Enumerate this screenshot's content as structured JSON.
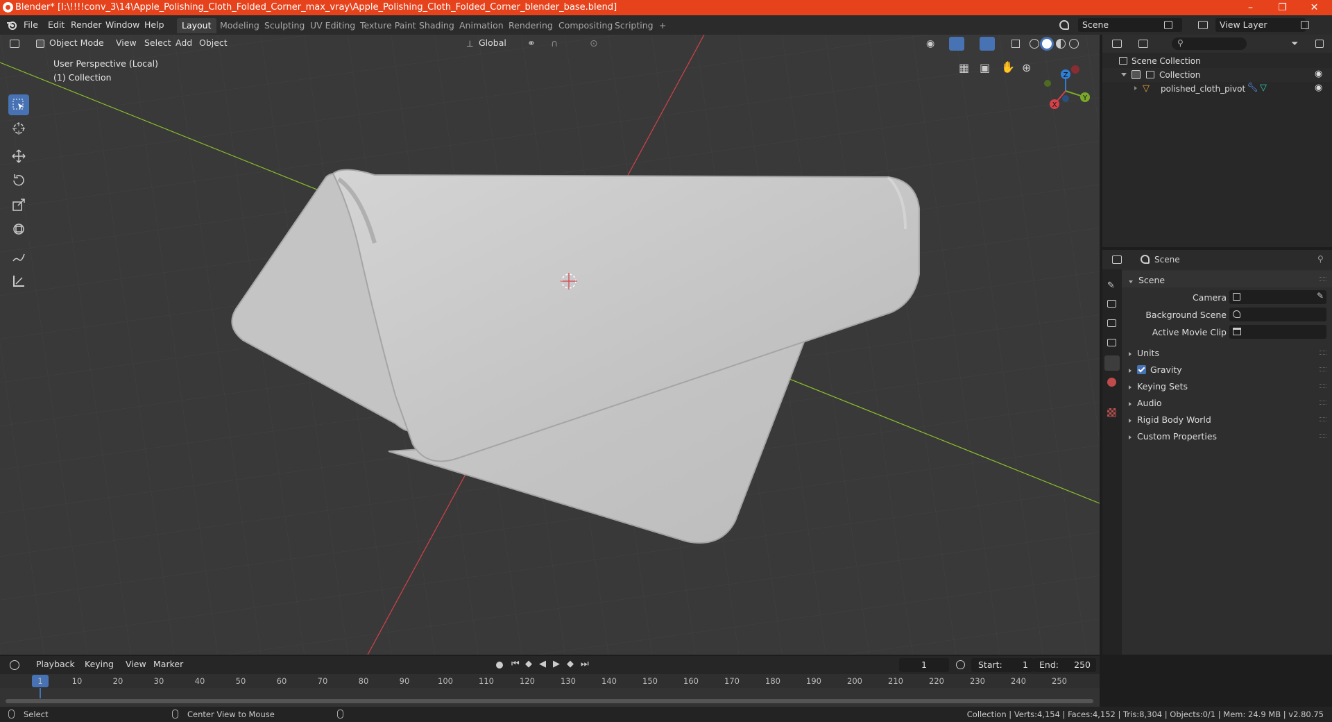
{
  "title_bar": {
    "title": "Blender* [I:\\!!!!conv_3\\14\\Apple_Polishing_Cloth_Folded_Corner_max_vray\\Apple_Polishing_Cloth_Folded_Corner_blender_base.blend]",
    "minimize": "–",
    "maximize": "❐",
    "close": "✕"
  },
  "menu": [
    "File",
    "Edit",
    "Render",
    "Window",
    "Help"
  ],
  "workspaces": [
    "Layout",
    "Modeling",
    "Sculpting",
    "UV Editing",
    "Texture Paint",
    "Shading",
    "Animation",
    "Rendering",
    "Compositing",
    "Scripting"
  ],
  "workspace_add": "+",
  "scene_selector": "Scene",
  "view_layer": "View Layer",
  "viewport": {
    "mode": "Object Mode",
    "menus": [
      "View",
      "Select",
      "Add",
      "Object"
    ],
    "transform_orientation": "Global",
    "overlay_title": "User Perspective (Local)",
    "overlay_collection": "(1) Collection",
    "gizmo_axes": {
      "x": "X",
      "y": "Y",
      "z": "Z"
    },
    "colors": {
      "bg": "#393939",
      "grid": "#454545",
      "x_axis": "#d6414a",
      "y_axis": "#8bbf2a",
      "cloth": "#c8c8c8"
    }
  },
  "outliner": {
    "search_placeholder": "",
    "scene_collection": "Scene Collection",
    "collection": "Collection",
    "object": "polished_cloth_pivot"
  },
  "properties": {
    "context": "Scene",
    "panel": "Scene",
    "camera_label": "Camera",
    "background_scene_label": "Background Scene",
    "active_movie_clip_label": "Active Movie Clip",
    "sections": [
      "Units",
      "Gravity",
      "Keying Sets",
      "Audio",
      "Rigid Body World",
      "Custom Properties"
    ]
  },
  "timeline": {
    "menus": [
      "Playback",
      "Keying",
      "View",
      "Marker"
    ],
    "current_frame": "1",
    "start_label": "Start:",
    "start": "1",
    "end_label": "End:",
    "end": "250",
    "ticks": [
      "1",
      "10",
      "20",
      "30",
      "40",
      "50",
      "60",
      "70",
      "80",
      "90",
      "100",
      "110",
      "120",
      "130",
      "140",
      "150",
      "160",
      "170",
      "180",
      "190",
      "200",
      "210",
      "220",
      "230",
      "240",
      "250"
    ]
  },
  "status": {
    "left": "Select",
    "middle": "Center View to Mouse",
    "right": "Collection | Verts:4,154 | Faces:4,152 | Tris:8,304 | Objects:0/1 | Mem: 24.9 MB | v2.80.75"
  }
}
